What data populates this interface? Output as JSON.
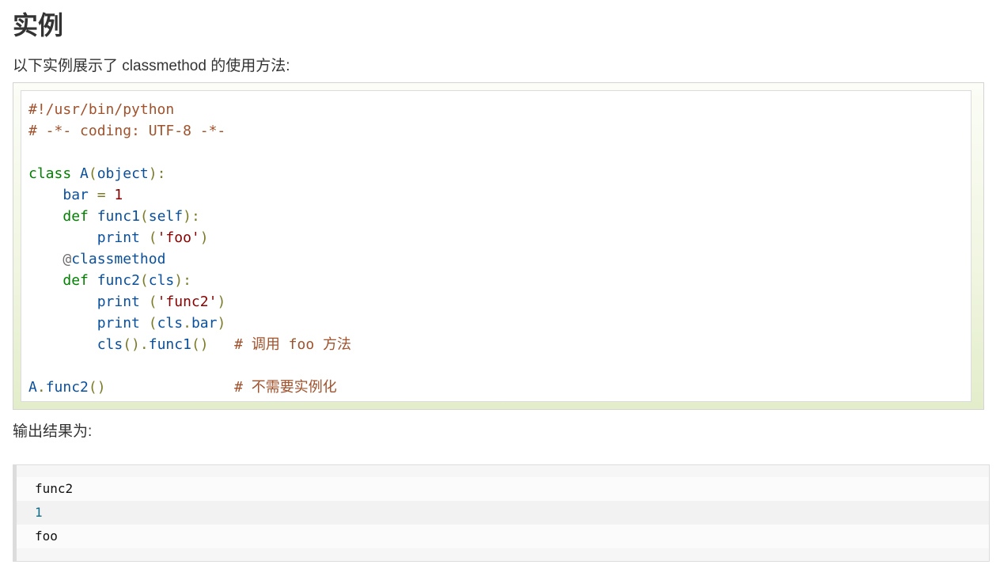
{
  "heading": "实例",
  "intro": "以下实例展示了 classmethod 的使用方法:",
  "code": {
    "l1": "#!/usr/bin/python",
    "l2": "# -*- coding: UTF-8 -*-",
    "l4_kw": "class",
    "l4_name": "A",
    "l4_paren_open": "(",
    "l4_base": "object",
    "l4_paren_close": "):",
    "l5_var": "bar",
    "l5_eq": "=",
    "l5_num": "1",
    "l6_kw": "def",
    "l6_name": "func1",
    "l6_paren_open": "(",
    "l6_arg": "self",
    "l6_paren_close": "):",
    "l7_fn": "print",
    "l7_paren_open": "(",
    "l7_str": "'foo'",
    "l7_paren_close": ")",
    "l8_dec": "@",
    "l8_name": "classmethod",
    "l9_kw": "def",
    "l9_name": "func2",
    "l9_paren_open": "(",
    "l9_arg": "cls",
    "l9_paren_close": "):",
    "l10_fn": "print",
    "l10_paren_open": "(",
    "l10_str": "'func2'",
    "l10_paren_close": ")",
    "l11_fn": "print",
    "l11_paren_open": "(",
    "l11_obj": "cls",
    "l11_dot": ".",
    "l11_attr": "bar",
    "l11_paren_close": ")",
    "l12_obj": "cls",
    "l12_call1": "()",
    "l12_dot": ".",
    "l12_fn": "func1",
    "l12_call2": "()",
    "l12_comment": "# 调用 foo 方法",
    "l14_obj": "A",
    "l14_dot": ".",
    "l14_fn": "func2",
    "l14_call": "()",
    "l14_comment": "# 不需要实例化"
  },
  "output_label": "输出结果为:",
  "output": {
    "line1": "func2",
    "line2": "1",
    "line3": "foo"
  }
}
